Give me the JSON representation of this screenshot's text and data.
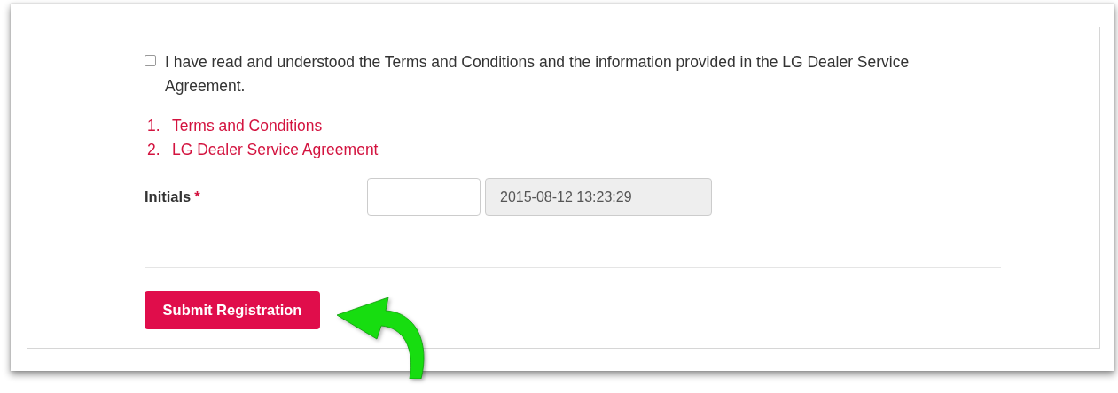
{
  "agreement": {
    "checked": false,
    "label": "I have read and understood the Terms and Conditions and the information provided in the LG Dealer Service Agreement."
  },
  "documents": [
    {
      "number": "1.",
      "label": "Terms and Conditions"
    },
    {
      "number": "2.",
      "label": "LG Dealer Service Agreement"
    }
  ],
  "initials": {
    "label": "Initials",
    "required_mark": "*",
    "timestamp": "2015-08-12 13:23:29"
  },
  "submit_button": {
    "label": "Submit Registration"
  }
}
